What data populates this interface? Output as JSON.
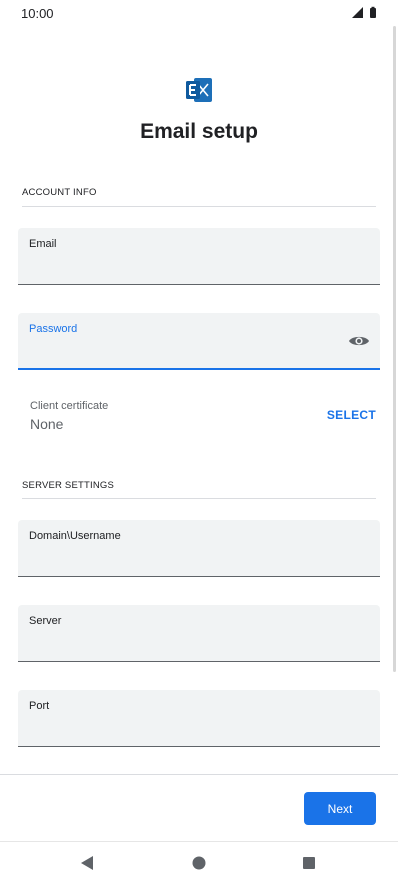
{
  "status_bar": {
    "time": "10:00",
    "icons": [
      "signal-icon",
      "battery-icon"
    ]
  },
  "header": {
    "logo_icon": "exchange-logo-icon",
    "title": "Email setup"
  },
  "account_info": {
    "section_title": "ACCOUNT INFO",
    "email": {
      "label": "Email",
      "value": ""
    },
    "password": {
      "label": "Password",
      "value": "",
      "toggle_icon": "eye-icon"
    },
    "client_certificate": {
      "label": "Client certificate",
      "value": "None",
      "action": "SELECT"
    }
  },
  "server_settings": {
    "section_title": "SERVER SETTINGS",
    "domain_username": {
      "label": "Domain\\Username",
      "value": ""
    },
    "server": {
      "label": "Server",
      "value": ""
    },
    "port": {
      "label": "Port",
      "value": ""
    }
  },
  "footer": {
    "next_label": "Next"
  },
  "nav_bar": {
    "icons": [
      "back-icon",
      "home-icon",
      "recents-icon"
    ]
  },
  "colors": {
    "accent": "#1a73e8",
    "field_bg": "#f1f3f4",
    "text": "#202124",
    "muted": "#5f6368",
    "divider": "#dadce0"
  }
}
